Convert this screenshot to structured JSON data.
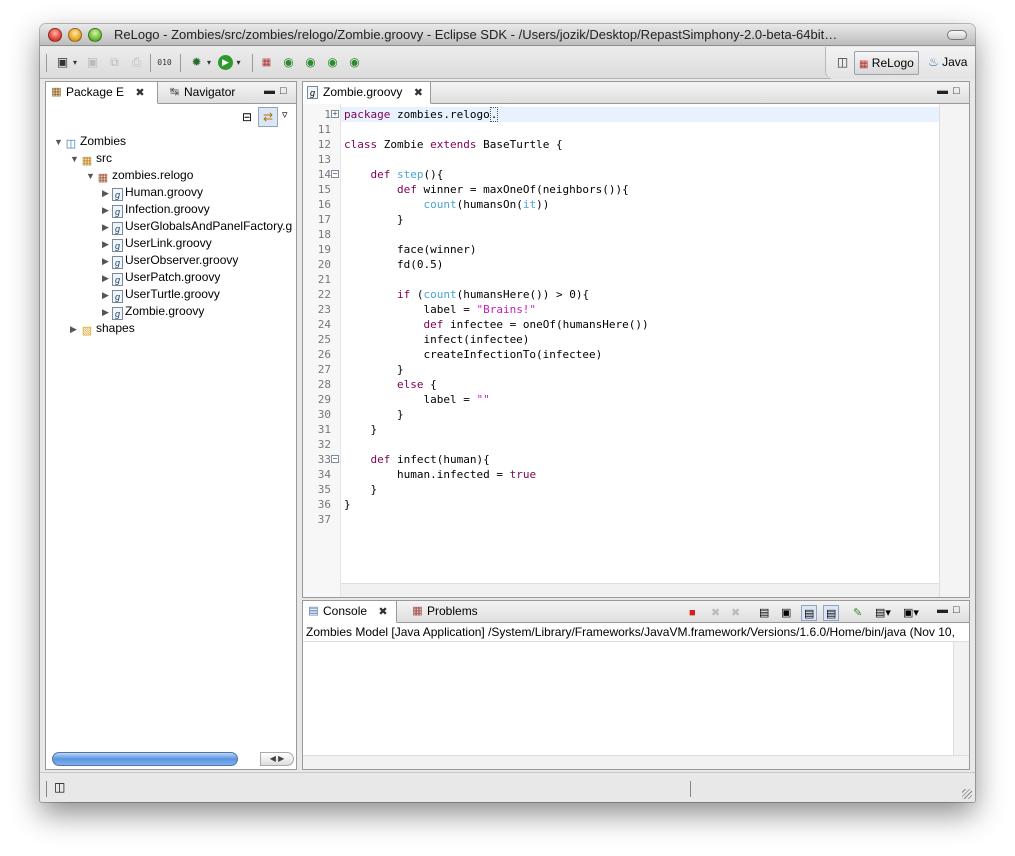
{
  "window": {
    "title": "ReLogo - Zombies/src/zombies/relogo/Zombie.groovy - Eclipse SDK - /Users/jozik/Desktop/RepastSimphony-2.0-beta-64bit…"
  },
  "toolbar": {
    "icons": [
      "new-icon",
      "save-icon",
      "save-all-icon",
      "print-icon",
      "binary-icon",
      "debug-icon",
      "run-icon",
      "relogo-new-icon",
      "new-turtle-icon",
      "new-patch-icon",
      "new-link-icon",
      "new-observer-icon"
    ]
  },
  "perspectives": {
    "relogo": "ReLogo",
    "java": "Java"
  },
  "left_panel": {
    "tabs": [
      {
        "label": "Package E",
        "active": true
      },
      {
        "label": "Navigator",
        "active": false
      }
    ],
    "tree": [
      {
        "label": "Zombies",
        "depth": 0,
        "expanded": true,
        "icon": "project-icon"
      },
      {
        "label": "src",
        "depth": 1,
        "expanded": true,
        "icon": "source-folder-icon"
      },
      {
        "label": "zombies.relogo",
        "depth": 2,
        "expanded": true,
        "icon": "package-icon"
      },
      {
        "label": "Human.groovy",
        "depth": 3,
        "expanded": false,
        "icon": "groovy-file-icon"
      },
      {
        "label": "Infection.groovy",
        "depth": 3,
        "expanded": false,
        "icon": "groovy-file-icon"
      },
      {
        "label": "UserGlobalsAndPanelFactory.g",
        "depth": 3,
        "expanded": false,
        "icon": "groovy-file-icon"
      },
      {
        "label": "UserLink.groovy",
        "depth": 3,
        "expanded": false,
        "icon": "groovy-file-icon"
      },
      {
        "label": "UserObserver.groovy",
        "depth": 3,
        "expanded": false,
        "icon": "groovy-file-icon"
      },
      {
        "label": "UserPatch.groovy",
        "depth": 3,
        "expanded": false,
        "icon": "groovy-file-icon"
      },
      {
        "label": "UserTurtle.groovy",
        "depth": 3,
        "expanded": false,
        "icon": "groovy-file-icon"
      },
      {
        "label": "Zombie.groovy",
        "depth": 3,
        "expanded": false,
        "icon": "groovy-file-icon"
      },
      {
        "label": "shapes",
        "depth": 1,
        "expanded": false,
        "icon": "folder-icon"
      }
    ]
  },
  "editor": {
    "tab_label": "Zombie.groovy",
    "lines": [
      {
        "n": "1",
        "fold": "plus",
        "code": [
          [
            "kw",
            "package"
          ],
          [
            "t",
            " zombies.relogo"
          ],
          [
            "t",
            "."
          ]
        ]
      },
      {
        "n": "11",
        "fold": "",
        "code": []
      },
      {
        "n": "12",
        "fold": "",
        "code": [
          [
            "kw",
            "class"
          ],
          [
            "t",
            " Zombie "
          ],
          [
            "kw",
            "extends"
          ],
          [
            "t",
            " BaseTurtle {"
          ]
        ]
      },
      {
        "n": "13",
        "fold": "",
        "code": []
      },
      {
        "n": "14",
        "fold": "minus",
        "code": [
          [
            "t",
            "    "
          ],
          [
            "kw",
            "def"
          ],
          [
            "t",
            " "
          ],
          [
            "fn",
            "step"
          ],
          [
            "t",
            "(){"
          ]
        ]
      },
      {
        "n": "15",
        "fold": "",
        "code": [
          [
            "t",
            "        "
          ],
          [
            "kw",
            "def"
          ],
          [
            "t",
            " winner = maxOneOf(neighbors()){"
          ]
        ]
      },
      {
        "n": "16",
        "fold": "",
        "code": [
          [
            "t",
            "            "
          ],
          [
            "fn",
            "count"
          ],
          [
            "t",
            "(humansOn("
          ],
          [
            "fn",
            "it"
          ],
          [
            "t",
            "))"
          ]
        ]
      },
      {
        "n": "17",
        "fold": "",
        "code": [
          [
            "t",
            "        }"
          ]
        ]
      },
      {
        "n": "18",
        "fold": "",
        "code": []
      },
      {
        "n": "19",
        "fold": "",
        "code": [
          [
            "t",
            "        face(winner)"
          ]
        ]
      },
      {
        "n": "20",
        "fold": "",
        "code": [
          [
            "t",
            "        fd(0.5)"
          ]
        ]
      },
      {
        "n": "21",
        "fold": "",
        "code": []
      },
      {
        "n": "22",
        "fold": "",
        "code": [
          [
            "t",
            "        "
          ],
          [
            "kw",
            "if"
          ],
          [
            "t",
            " ("
          ],
          [
            "fn",
            "count"
          ],
          [
            "t",
            "(humansHere()) > 0){"
          ]
        ]
      },
      {
        "n": "23",
        "fold": "",
        "code": [
          [
            "t",
            "            label = "
          ],
          [
            "str",
            "\"Brains!\""
          ]
        ]
      },
      {
        "n": "24",
        "fold": "",
        "code": [
          [
            "t",
            "            "
          ],
          [
            "kw",
            "def"
          ],
          [
            "t",
            " infectee = oneOf(humansHere())"
          ]
        ]
      },
      {
        "n": "25",
        "fold": "",
        "code": [
          [
            "t",
            "            infect(infectee)"
          ]
        ]
      },
      {
        "n": "26",
        "fold": "",
        "code": [
          [
            "t",
            "            createInfectionTo(infectee)"
          ]
        ]
      },
      {
        "n": "27",
        "fold": "",
        "code": [
          [
            "t",
            "        }"
          ]
        ]
      },
      {
        "n": "28",
        "fold": "",
        "code": [
          [
            "t",
            "        "
          ],
          [
            "kw",
            "else"
          ],
          [
            "t",
            " {"
          ]
        ]
      },
      {
        "n": "29",
        "fold": "",
        "code": [
          [
            "t",
            "            label = "
          ],
          [
            "str",
            "\"\""
          ]
        ]
      },
      {
        "n": "30",
        "fold": "",
        "code": [
          [
            "t",
            "        }"
          ]
        ]
      },
      {
        "n": "31",
        "fold": "",
        "code": [
          [
            "t",
            "    }"
          ]
        ]
      },
      {
        "n": "32",
        "fold": "",
        "code": []
      },
      {
        "n": "33",
        "fold": "minus",
        "code": [
          [
            "t",
            "    "
          ],
          [
            "kw",
            "def"
          ],
          [
            "t",
            " infect(human){"
          ]
        ]
      },
      {
        "n": "34",
        "fold": "",
        "code": [
          [
            "t",
            "        human.infected = "
          ],
          [
            "kw",
            "true"
          ]
        ]
      },
      {
        "n": "35",
        "fold": "",
        "code": [
          [
            "t",
            "    }"
          ]
        ]
      },
      {
        "n": "36",
        "fold": "",
        "code": [
          [
            "t",
            "}"
          ]
        ]
      },
      {
        "n": "37",
        "fold": "",
        "code": []
      }
    ]
  },
  "bottom_panel": {
    "tabs": [
      {
        "label": "Console",
        "active": true
      },
      {
        "label": "Problems",
        "active": false
      }
    ],
    "console_header": "Zombies Model [Java Application] /System/Library/Frameworks/JavaVM.framework/Versions/1.6.0/Home/bin/java (Nov 10,"
  },
  "colors": {
    "keyword": "#7f0055",
    "method": "#4aa6d6",
    "string": "#c020c0",
    "selection_tab": "#ffffff",
    "scrollbar_blue": "#5a95e0"
  }
}
